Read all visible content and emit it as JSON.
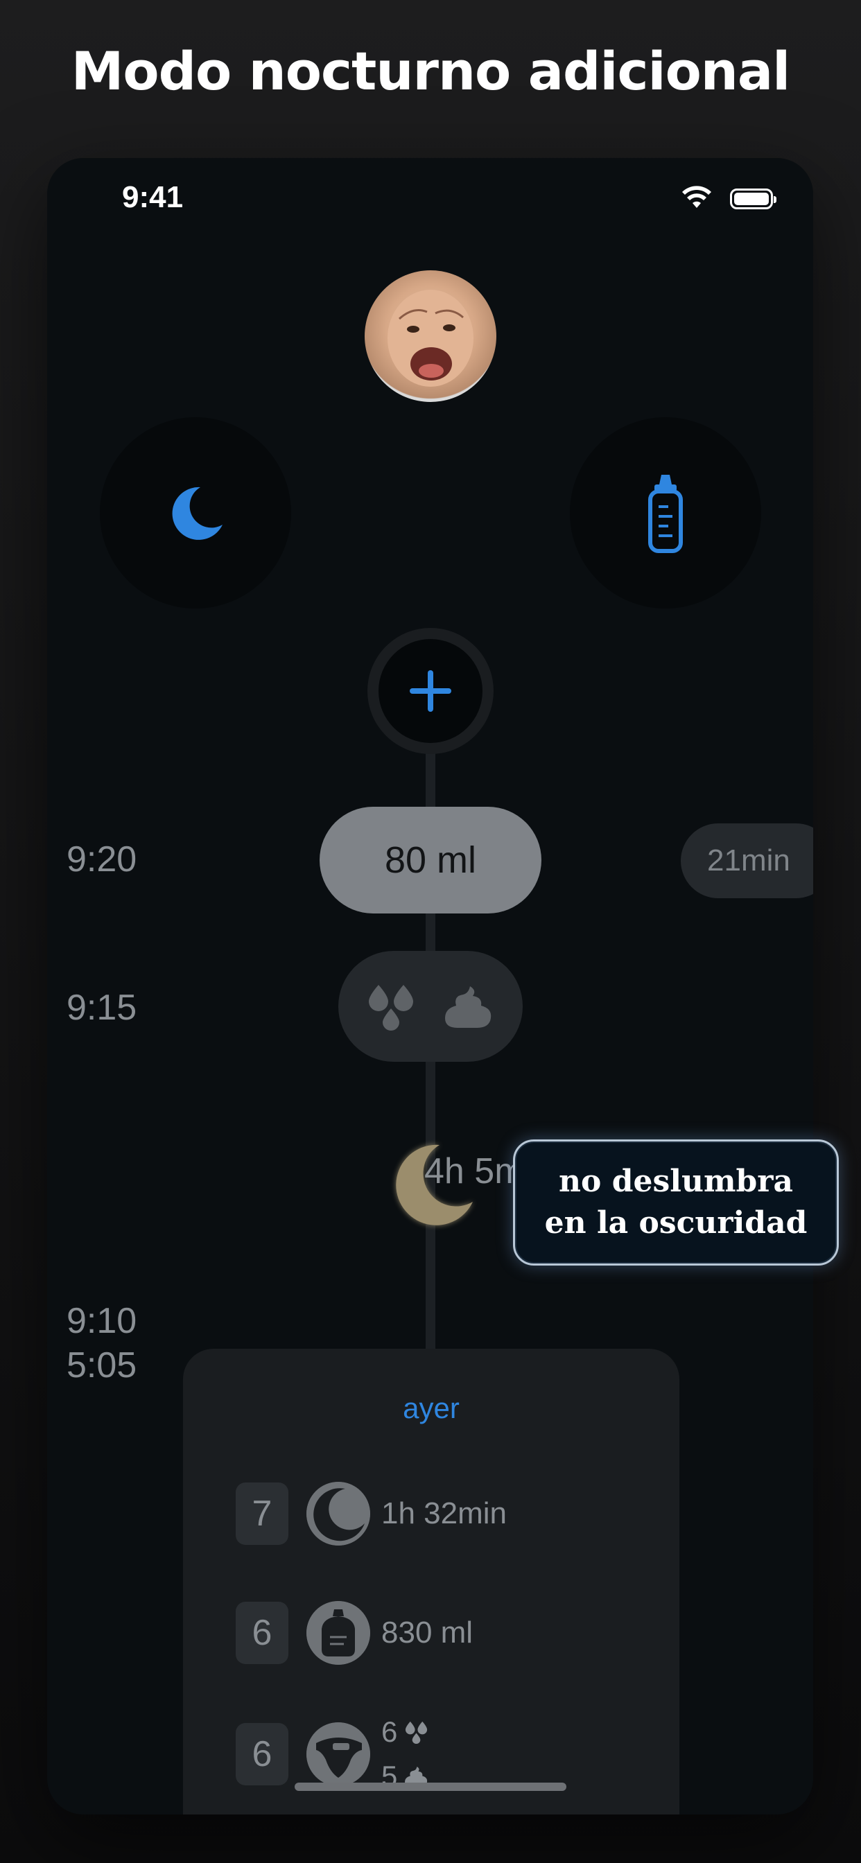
{
  "headline": "Modo nocturno adicional",
  "status_bar": {
    "time": "9:41"
  },
  "actions": {
    "sleep_icon": "moon-icon",
    "bottle_icon": "baby-bottle-icon",
    "add_icon": "plus-icon"
  },
  "timeline": [
    {
      "time": "9:20",
      "label": "80 ml",
      "duration": "21min"
    },
    {
      "time": "9:15",
      "icons": [
        "pee-drops-icon",
        "poop-icon"
      ]
    },
    {
      "time_start": "9:10",
      "time_end": "5:05",
      "label": "4h 5min"
    }
  ],
  "callout": {
    "line1": "no deslumbra",
    "line2": "en la oscuridad"
  },
  "summary": {
    "title": "ayer",
    "rows": [
      {
        "count": "7",
        "icon": "sleep-moon-icon",
        "text": "1h 32min"
      },
      {
        "count": "6",
        "icon": "bottle-icon",
        "text": "830 ml"
      },
      {
        "count": "6",
        "icon": "diaper-icon",
        "pee_count": "6",
        "poop_count": "5"
      }
    ]
  },
  "colors": {
    "accent": "#2f86e0",
    "background": "#0a0e11",
    "sleep_moon": "#9b8d6c"
  }
}
